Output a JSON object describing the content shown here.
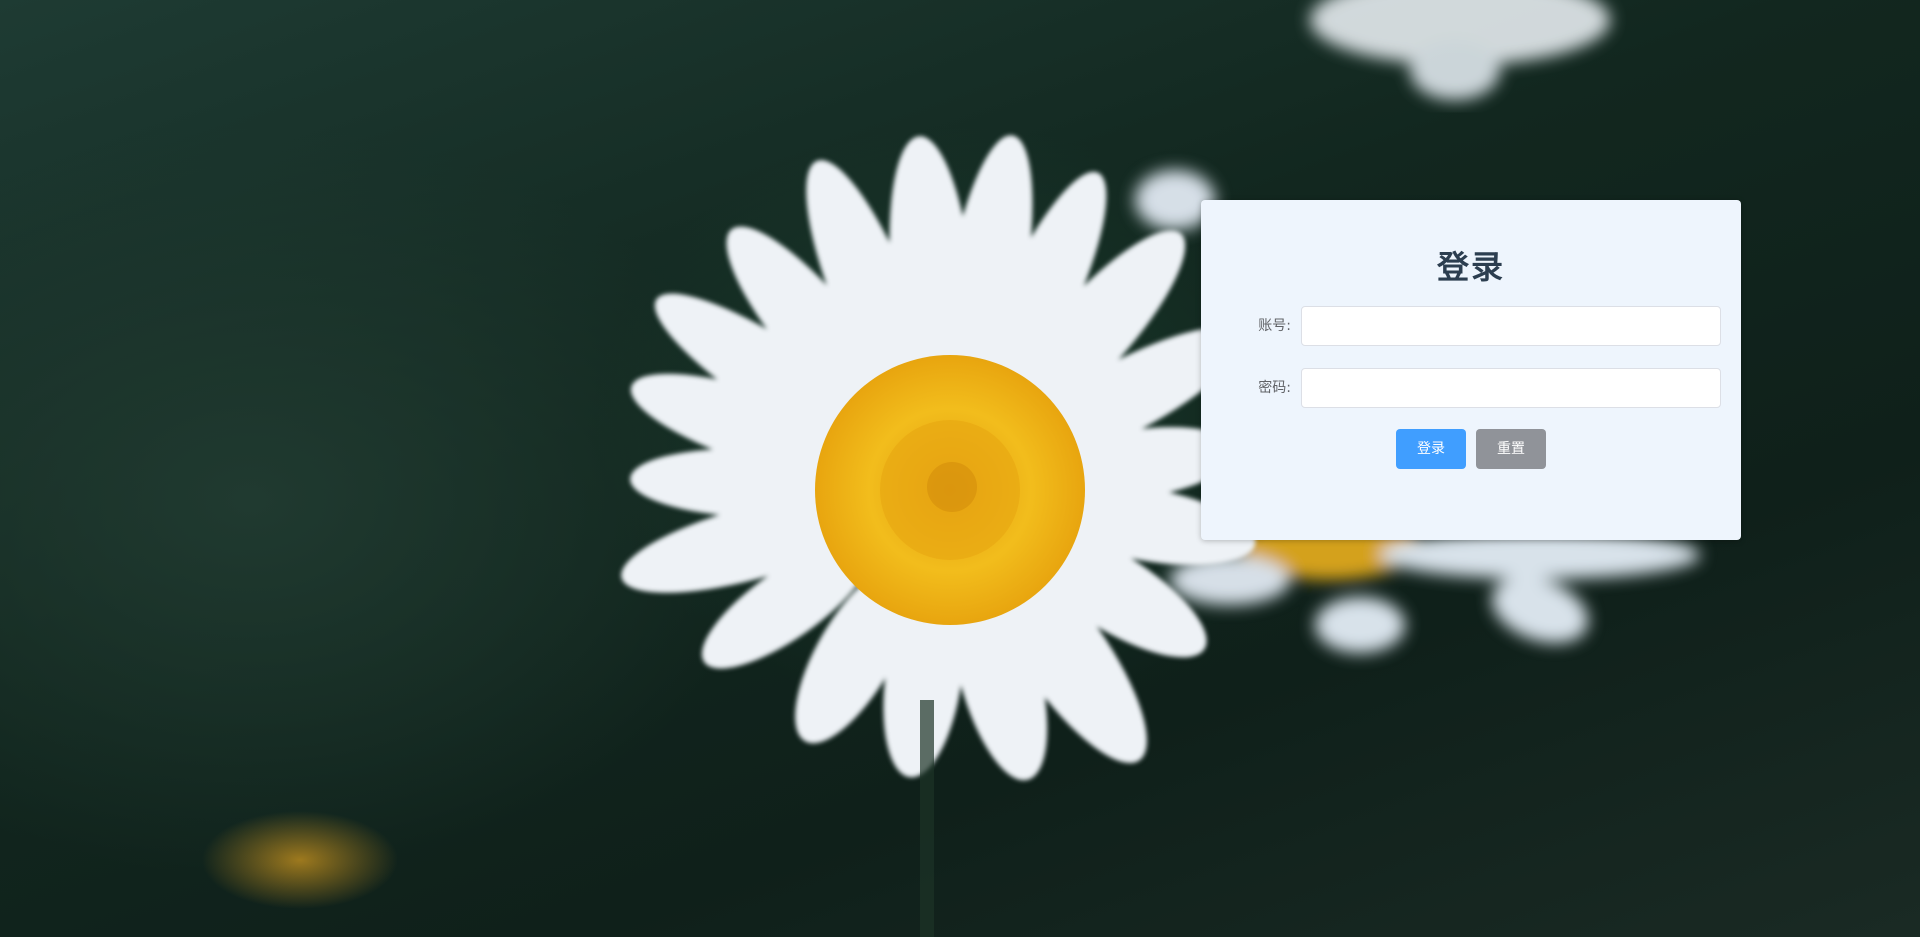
{
  "login": {
    "title": "登录",
    "account_label": "账号:",
    "account_value": "",
    "password_label": "密码:",
    "password_value": "",
    "login_button": "登录",
    "reset_button": "重置"
  },
  "colors": {
    "primary": "#409eff",
    "info": "#909399",
    "card_bg": "#eef5fd",
    "title": "#2c3e50"
  }
}
